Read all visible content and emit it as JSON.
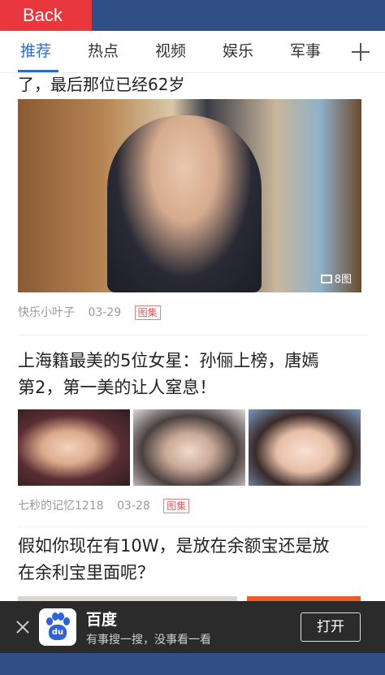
{
  "nav": {
    "back_label": "Back"
  },
  "tabs": [
    {
      "label": "推荐",
      "active": true
    },
    {
      "label": "热点"
    },
    {
      "label": "视频"
    },
    {
      "label": "娱乐"
    },
    {
      "label": "军事"
    }
  ],
  "feed": {
    "cut_title": "了，最后那位已经62岁",
    "article1": {
      "photo_count": "8图",
      "author": "快乐小叶子",
      "date": "03-29",
      "tag": "图集"
    },
    "article2": {
      "title_line1": "上海籍最美的5位女星：孙俪上榜，唐嫣",
      "title_line2": "第2，第一美的让人窒息！",
      "author": "七秒的记忆1218",
      "date": "03-28",
      "tag": "图集"
    },
    "article3": {
      "title_line1": "假如你现在有10W，是放在余额宝还是放",
      "title_line2": "在余利宝里面呢？"
    }
  },
  "banner": {
    "app_name": "百度",
    "logo_text": "du",
    "slogan": "有事搜一搜，没事看一看",
    "open_label": "打开"
  },
  "colors": {
    "accent": "#2b6ad1",
    "nav_bar": "#2f4f86",
    "back_button": "#e8383d",
    "tag": "#e25560"
  }
}
